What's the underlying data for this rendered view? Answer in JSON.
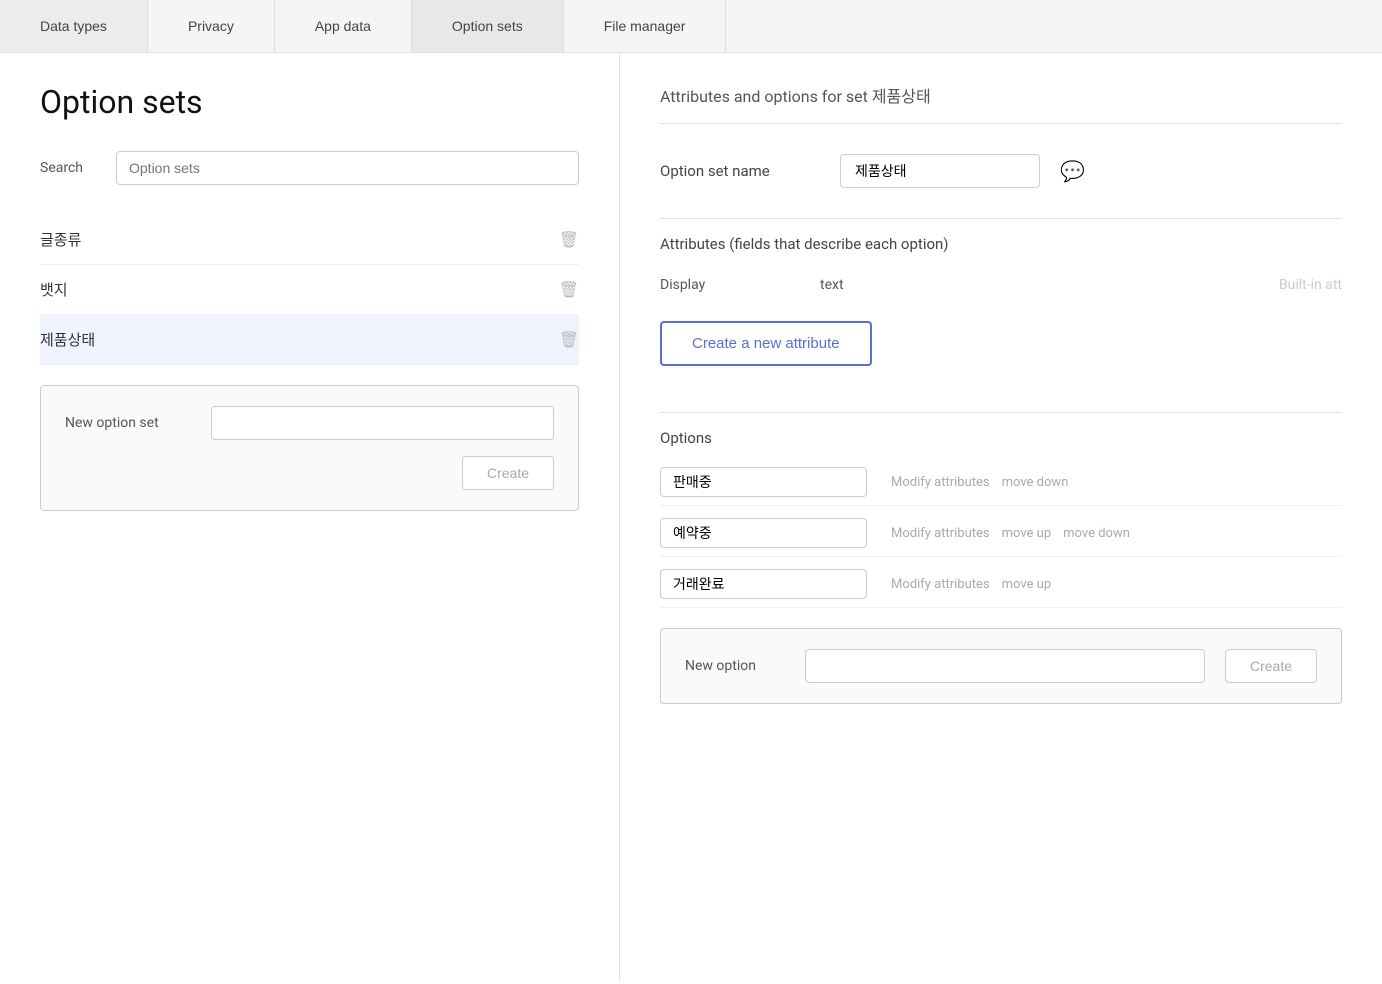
{
  "nav": {
    "tabs": [
      {
        "label": "Data types",
        "active": false
      },
      {
        "label": "Privacy",
        "active": false
      },
      {
        "label": "App data",
        "active": false
      },
      {
        "label": "Option sets",
        "active": true
      },
      {
        "label": "File manager",
        "active": false
      }
    ]
  },
  "left": {
    "title": "Option sets",
    "search": {
      "label": "Search",
      "placeholder": "Option sets"
    },
    "items": [
      {
        "name": "글종류"
      },
      {
        "name": "뱃지"
      },
      {
        "name": "제품상태"
      }
    ],
    "new_option_set": {
      "label": "New option set",
      "input_placeholder": "",
      "create_label": "Create"
    }
  },
  "right": {
    "header": "Attributes and options for set 제품상태",
    "option_set_name_label": "Option set name",
    "option_set_name_value": "제품상태",
    "attributes_section_label": "Attributes (fields that describe each option)",
    "display_attribute": {
      "name": "Display",
      "type": "text",
      "builtin": "Built-in att"
    },
    "create_attr_label": "Create a new attribute",
    "options_section_label": "Options",
    "options": [
      {
        "value": "판매중",
        "actions": [
          "Modify attributes",
          "move down"
        ]
      },
      {
        "value": "예약중",
        "actions": [
          "Modify attributes",
          "move up",
          "move down"
        ]
      },
      {
        "value": "거래완료",
        "actions": [
          "Modify attributes",
          "move up"
        ]
      }
    ],
    "new_option": {
      "label": "New option",
      "input_placeholder": "",
      "create_label": "Create"
    }
  },
  "icons": {
    "trash": "🗑",
    "comment": "💬"
  }
}
